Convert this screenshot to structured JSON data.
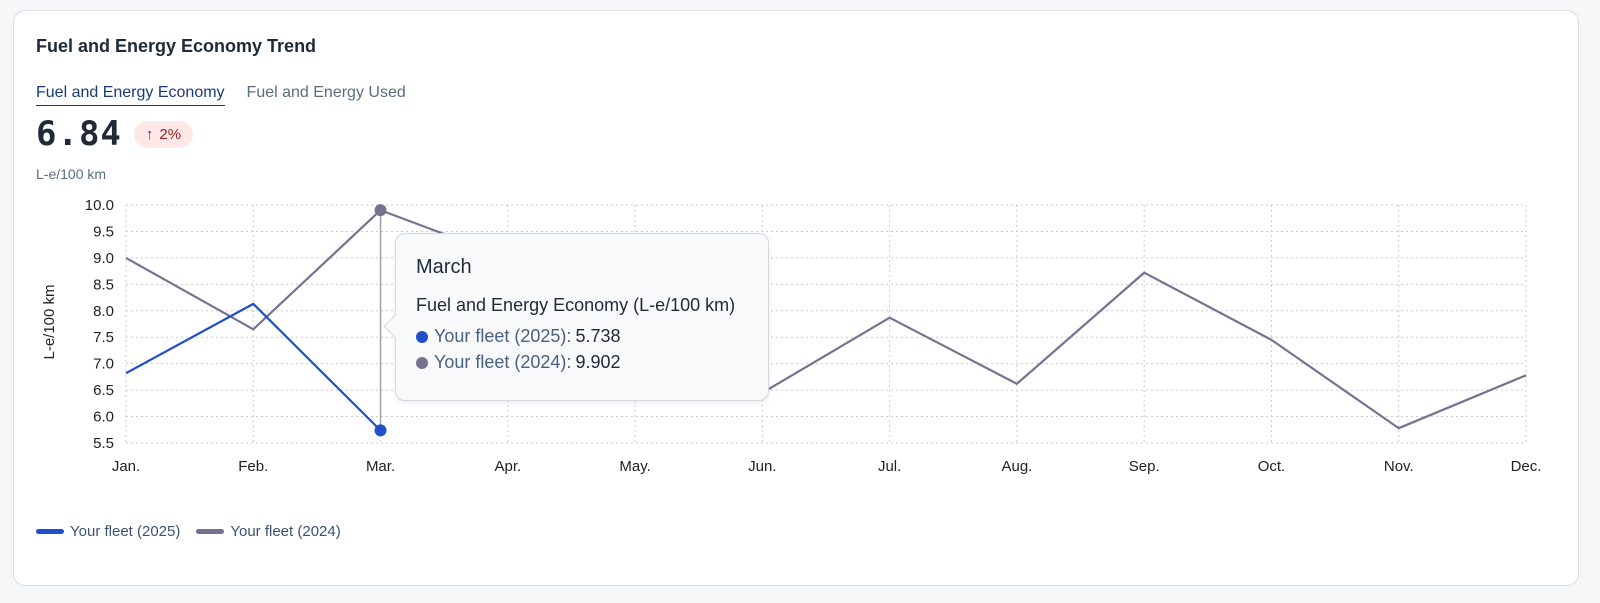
{
  "card": {
    "title": "Fuel and Energy Economy Trend",
    "tabs": [
      {
        "label": "Fuel and Energy Economy",
        "active": true
      },
      {
        "label": "Fuel and Energy Used",
        "active": false
      }
    ],
    "kpi": {
      "value": "6.84",
      "change": "2%",
      "change_direction": "up",
      "unit": "L-e/100 km"
    }
  },
  "colors": {
    "series_2025": "#1f4fc9",
    "series_2024": "#757291",
    "badge_bg": "#fde7e7",
    "badge_text": "#9b1c1c"
  },
  "chart_data": {
    "type": "line",
    "categories": [
      "Jan.",
      "Feb.",
      "Mar.",
      "Apr.",
      "May.",
      "Jun.",
      "Jul.",
      "Aug.",
      "Sep.",
      "Oct.",
      "Nov.",
      "Dec."
    ],
    "series": [
      {
        "name": "Your fleet (2025)",
        "values": [
          6.82,
          8.13,
          5.738,
          null,
          null,
          null,
          null,
          null,
          null,
          null,
          null,
          null
        ],
        "color": "#1f4fc9"
      },
      {
        "name": "Your fleet (2024)",
        "values": [
          9.0,
          7.65,
          9.902,
          9.0,
          8.0,
          6.45,
          7.87,
          6.62,
          8.72,
          7.45,
          5.78,
          6.78
        ],
        "color": "#757291"
      }
    ],
    "ylabel": "L-e/100 km",
    "xlabel": "",
    "ylim": [
      5.5,
      10.0
    ],
    "yticks": [
      "5.5",
      "6.0",
      "6.5",
      "7.0",
      "7.5",
      "8.0",
      "8.5",
      "9.0",
      "9.5",
      "10.0"
    ],
    "grid": true,
    "legend_position": "bottom-left",
    "highlight_index": 2
  },
  "tooltip": {
    "month": "March",
    "metric": "Fuel and Energy Economy (L-e/100 km)",
    "rows": [
      {
        "name": "Your fleet (2025):",
        "value": "5.738",
        "color": "#1f4fc9"
      },
      {
        "name": "Your fleet (2024):",
        "value": "9.902",
        "color": "#757291"
      }
    ]
  },
  "legend": [
    {
      "label": "Your fleet (2025)",
      "color": "#1f4fc9"
    },
    {
      "label": "Your fleet (2024)",
      "color": "#757291"
    }
  ]
}
